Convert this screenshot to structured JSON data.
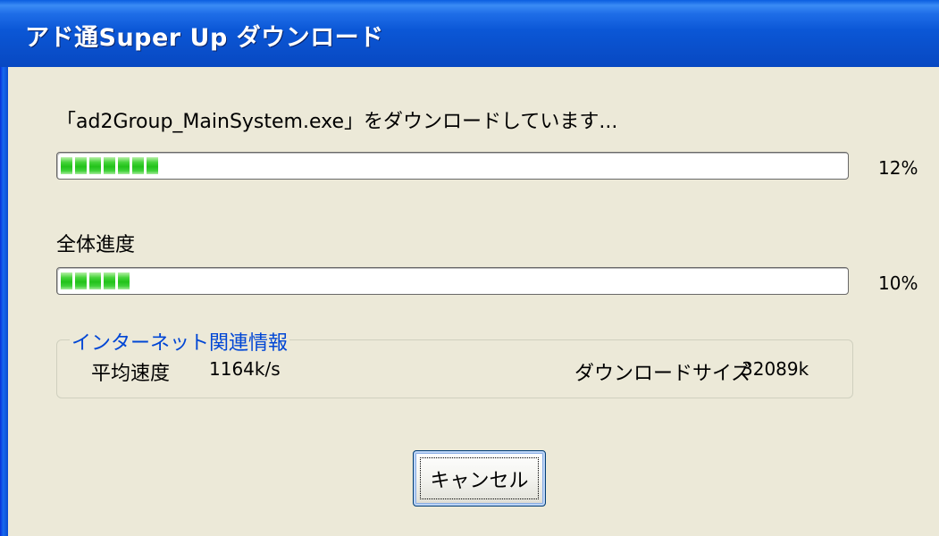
{
  "window": {
    "title": "アド通Super Up ダウンロード"
  },
  "file_status": {
    "label": "「ad2Group_MainSystem.exe」をダウンロードしています...",
    "progress_percent": 12,
    "progress_text": "12%"
  },
  "overall": {
    "label": "全体進度",
    "progress_percent": 10,
    "progress_text": "10%"
  },
  "internet_info": {
    "legend": "インターネット関連情報",
    "avg_speed_label": "平均速度",
    "avg_speed_value": "1164k/s",
    "download_size_label": "ダウンロードサイズ",
    "download_size_value": "32089k"
  },
  "actions": {
    "cancel_label": "キャンセル"
  },
  "colors": {
    "titlebar": "#0a50cc",
    "progress_fill": "#22c21a",
    "legend_text": "#0046d5",
    "background": "#ece9d8"
  }
}
